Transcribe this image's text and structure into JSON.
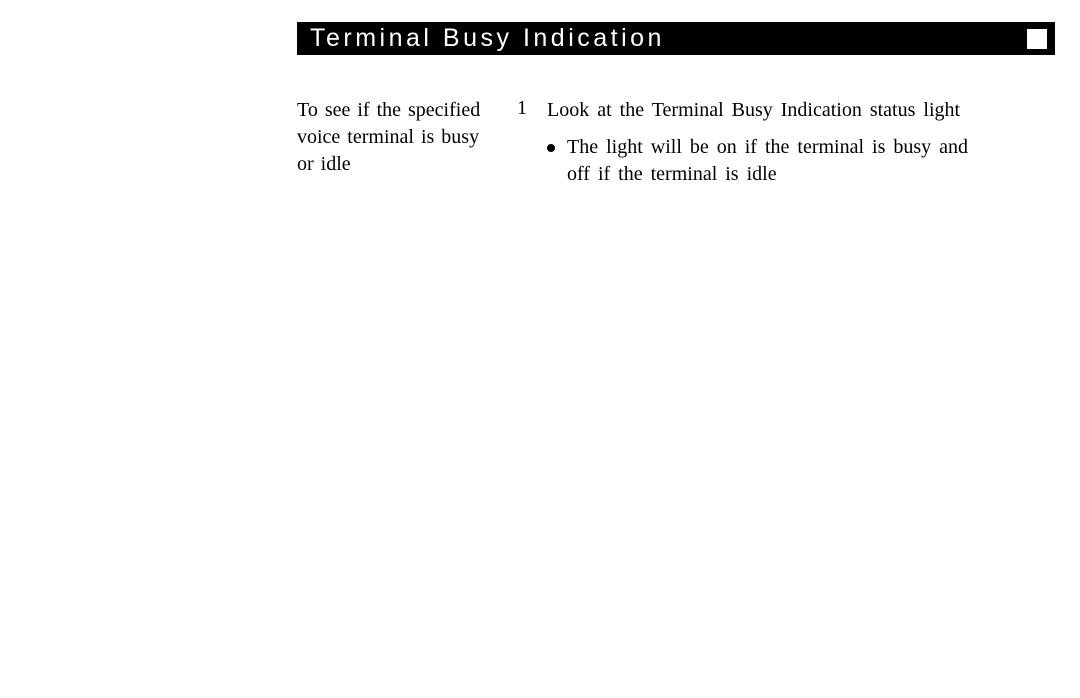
{
  "header": {
    "title": "Terminal Busy Indication"
  },
  "sidebar": {
    "text": "To see if the specified voice terminal is busy or idle"
  },
  "steps": {
    "s1": {
      "number": "1",
      "text": "Look at the Terminal Busy Indication status light",
      "bullet": "The light will be on if the terminal is busy and off if the terminal is idle"
    }
  }
}
